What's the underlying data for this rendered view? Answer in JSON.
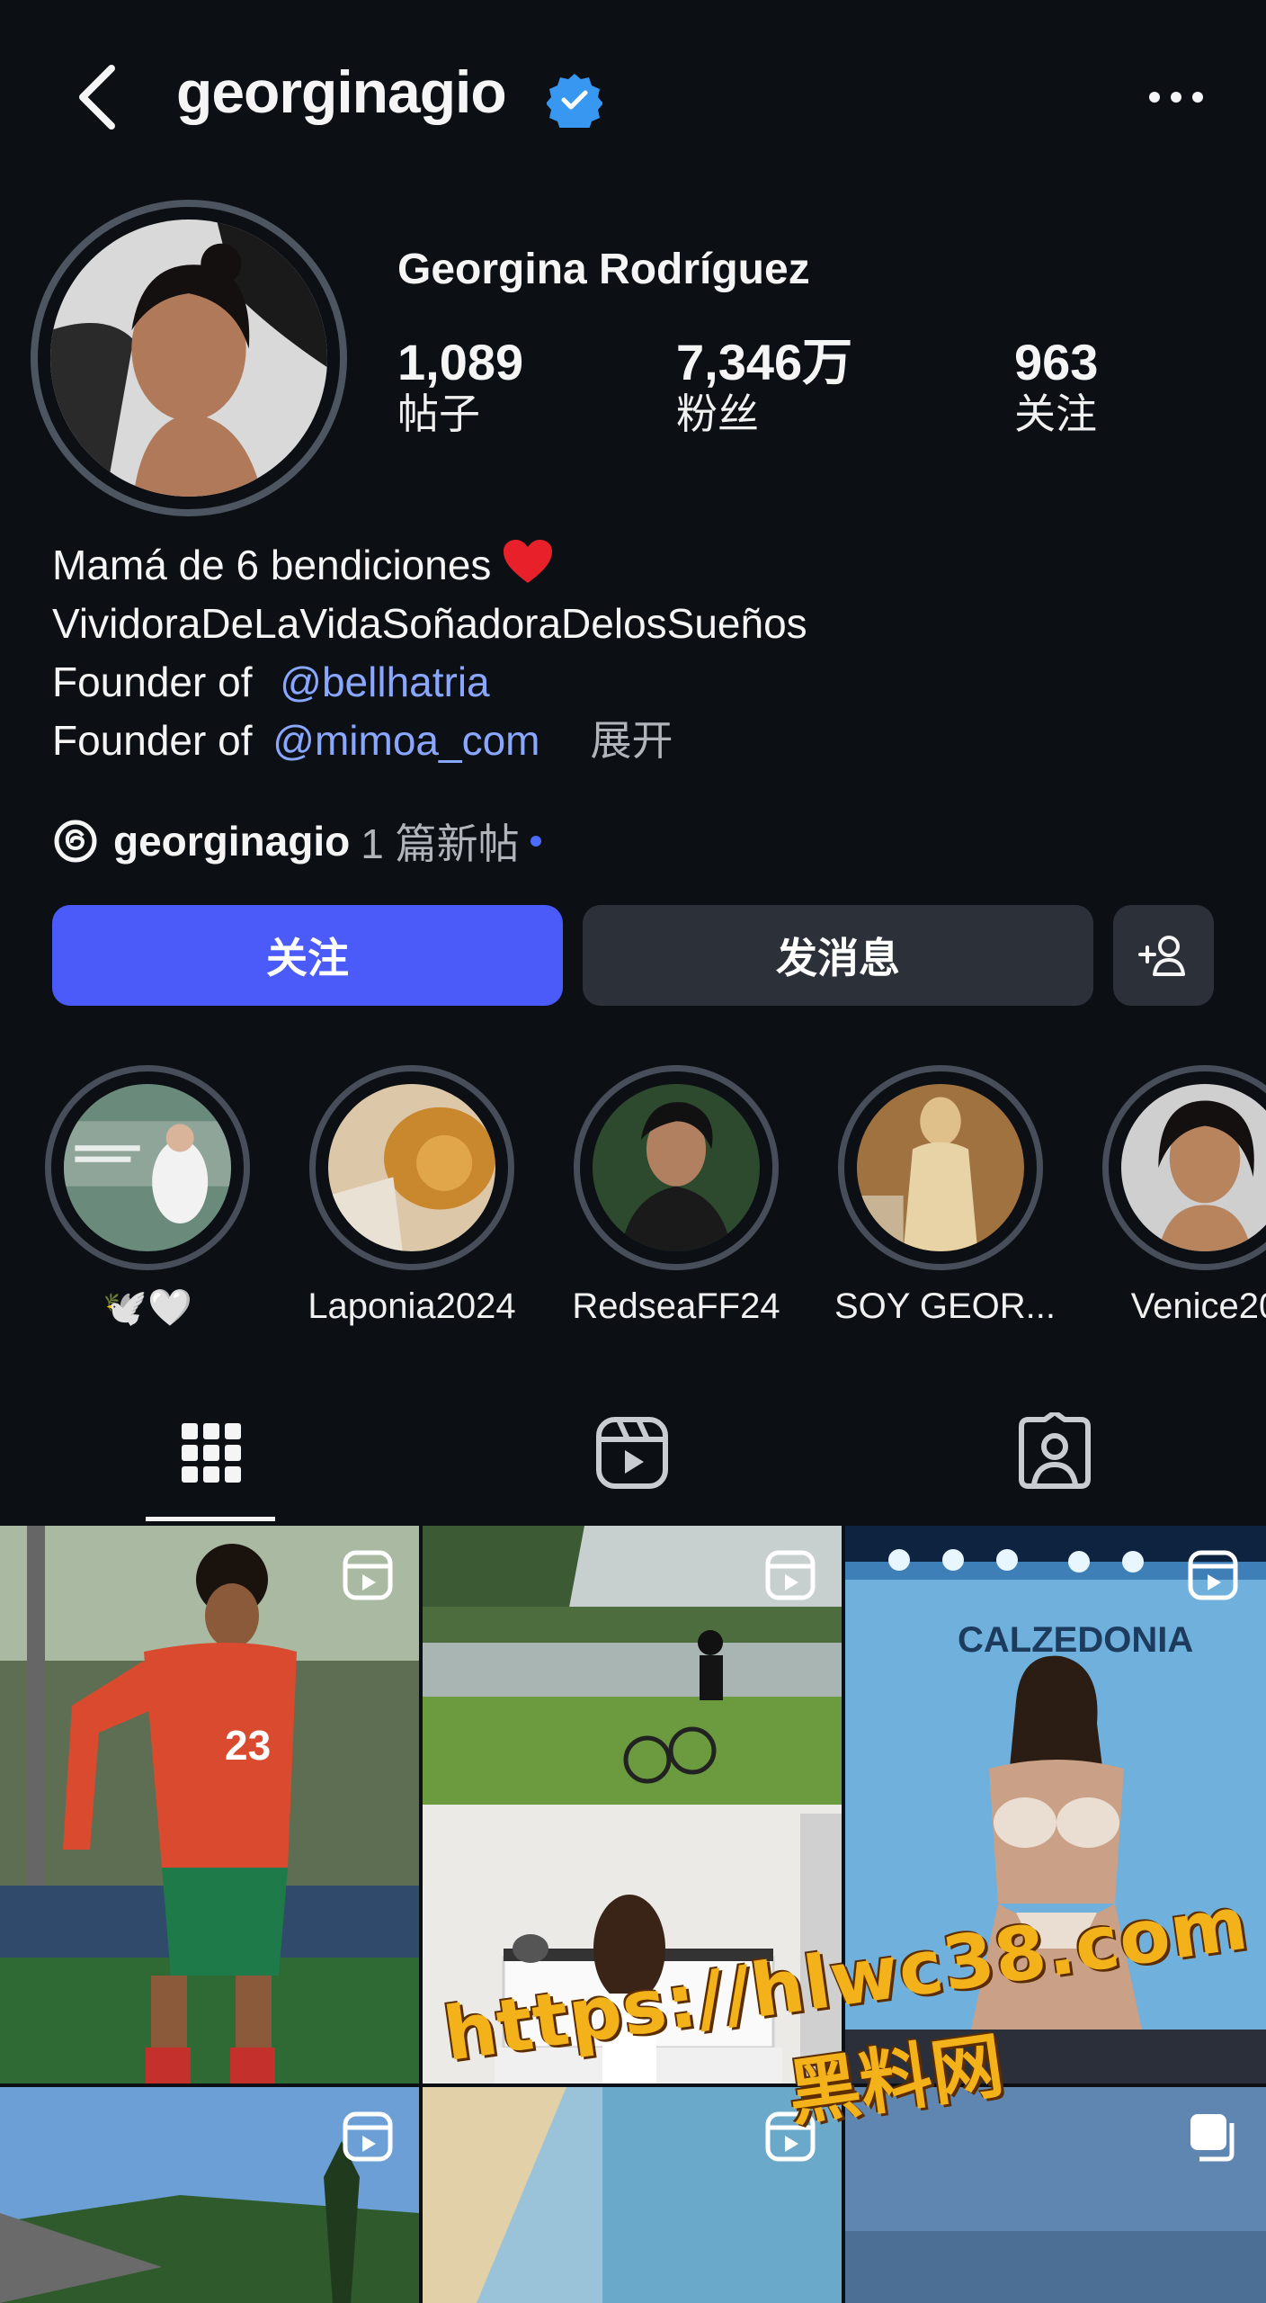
{
  "header": {
    "username": "georginagio",
    "back_icon": "chevron-left-icon",
    "verified_icon": "verified-badge-icon",
    "more_icon": "more-horizontal-icon"
  },
  "profile": {
    "full_name": "Georgina Rodríguez",
    "stats": [
      {
        "value": "1,089",
        "label": "帖子"
      },
      {
        "value": "7,346万",
        "label": "粉丝"
      },
      {
        "value": "963",
        "label": "关注"
      }
    ]
  },
  "bio": {
    "line1": "Mamá de 6 bendiciones",
    "line2": "VividoraDeLaVidaSoñadoraDelosSueños",
    "line3_prefix": "Founder of",
    "line3_mention": "@bellhatria",
    "line4_prefix": "Founder of",
    "line4_mention": "@mimoa_com",
    "expand": "展开"
  },
  "threads": {
    "name": "georginagio",
    "count": "1 篇新帖"
  },
  "buttons": {
    "follow": "关注",
    "message": "发消息"
  },
  "highlights": [
    {
      "label": "🕊️🤍"
    },
    {
      "label": "Laponia2024"
    },
    {
      "label": "RedseaFF24"
    },
    {
      "label": "SOY GEOR..."
    },
    {
      "label": "Venice20"
    }
  ],
  "tabs": [
    "grid-icon",
    "reels-icon",
    "tagged-icon"
  ],
  "overlay": {
    "url": "https://hlwc38.com",
    "name": "黑料网"
  },
  "colors": {
    "background": "#0c0f14",
    "follow_button": "#4a5bfa",
    "secondary_button": "#2c3038",
    "mention": "#8aa7ff",
    "verified": "#3897f0"
  }
}
